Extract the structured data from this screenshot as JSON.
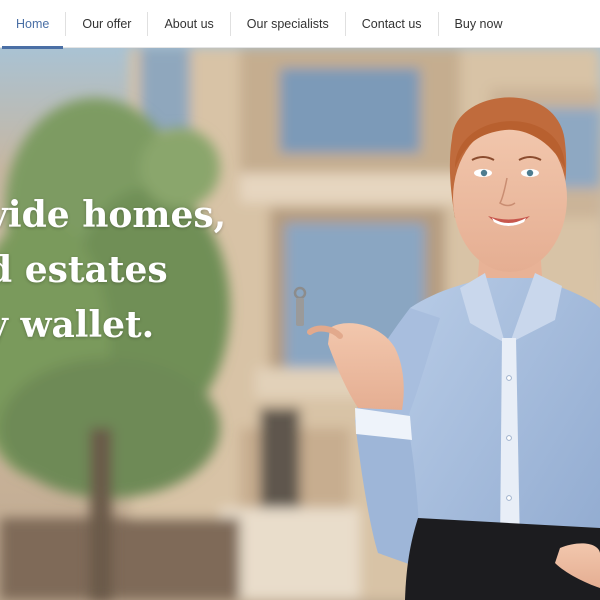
{
  "nav": {
    "items": [
      {
        "label": "Home",
        "active": true
      },
      {
        "label": "Our offer",
        "active": false
      },
      {
        "label": "About us",
        "active": false
      },
      {
        "label": "Our specialists",
        "active": false
      },
      {
        "label": "Contact us",
        "active": false
      },
      {
        "label": "Buy now",
        "active": false
      }
    ]
  },
  "hero": {
    "line1": "vide homes,",
    "line2": "d estates",
    "line3": "y wallet."
  },
  "colors": {
    "accent": "#4a6fa5",
    "nav_text": "#333333",
    "hero_text": "#ffffff"
  }
}
